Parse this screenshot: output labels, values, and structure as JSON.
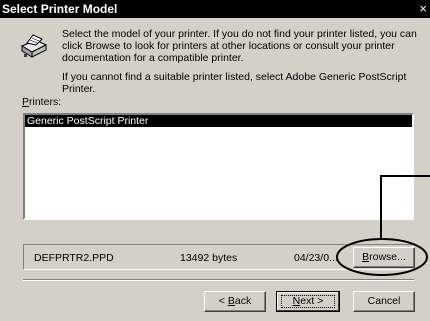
{
  "dialog": {
    "title": "Select Printer Model",
    "close_glyph": "×"
  },
  "instructions": {
    "paragraph1": "Select the model of your printer. If you do not find your printer listed, you can click Browse to look for printers at other locations or consult your printer documentation for a compatible printer.",
    "paragraph2": "If you cannot find a suitable printer listed, select Adobe Generic PostScript Printer."
  },
  "printers": {
    "label_underlined": "P",
    "label_rest": "rinters:",
    "items": [
      "Generic PostScript Printer"
    ],
    "selected_index": 0
  },
  "file": {
    "name": "DEFPRTR2.PPD",
    "size": "13492 bytes",
    "date": "04/23/0..."
  },
  "buttons": {
    "browse_pre": "",
    "browse_ul": "B",
    "browse_post": "rowse...",
    "back_pre": "< ",
    "back_ul": "B",
    "back_post": "ack",
    "next_ul": "N",
    "next_post": "ext >",
    "cancel": "Cancel"
  },
  "icon_name": "printer-icon"
}
